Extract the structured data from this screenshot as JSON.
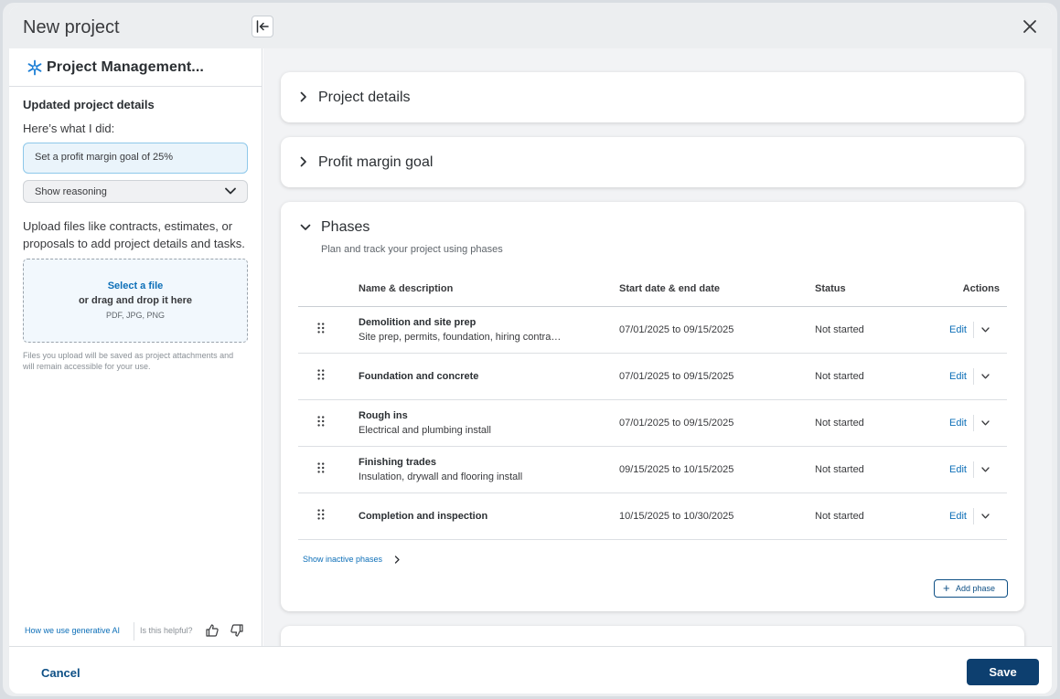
{
  "modal": {
    "title": "New project"
  },
  "sidebar": {
    "title": "Project Management...",
    "heading": "Updated project details",
    "subheading": "Here’s what I did:",
    "ai_action": "Set a profit margin goal of 25%",
    "reasoning_label": "Show reasoning",
    "upload_text": "Upload files like contracts, estimates, or proposals to add project details and tasks.",
    "dropzone": {
      "select_label": "Select a file",
      "drag_text": "or drag and drop it here",
      "types": "PDF, JPG, PNG"
    },
    "files_note": "Files you upload will be saved as project attachments and will remain accessible for your use.",
    "footer": {
      "ai_link": "How we use generative AI",
      "helpful_text": "Is this helpful?"
    }
  },
  "sections": [
    {
      "title": "Project details",
      "expanded": false
    },
    {
      "title": "Profit margin goal",
      "expanded": false
    }
  ],
  "phases": {
    "title": "Phases",
    "subtitle": "Plan and track your project using phases",
    "columns": [
      "Name & description",
      "Start date & end date",
      "Status",
      "Actions"
    ],
    "rows": [
      {
        "name": "Demolition and site prep",
        "description": "Site prep, permits, foundation, hiring contra…",
        "dates": "07/01/2025 to 09/15/2025",
        "status": "Not started",
        "action": "Edit"
      },
      {
        "name": "Foundation and concrete",
        "description": "",
        "dates": "07/01/2025 to 09/15/2025",
        "status": "Not started",
        "action": "Edit"
      },
      {
        "name": "Rough ins",
        "description": "Electrical and plumbing install",
        "dates": "07/01/2025 to 09/15/2025",
        "status": "Not started",
        "action": "Edit"
      },
      {
        "name": "Finishing trades",
        "description": "Insulation, drywall and flooring install",
        "dates": "09/15/2025 to 10/15/2025",
        "status": "Not started",
        "action": "Edit"
      },
      {
        "name": "Completion and inspection",
        "description": "",
        "dates": "10/15/2025 to 10/30/2025",
        "status": "Not started",
        "action": "Edit"
      }
    ],
    "show_inactive": "Show inactive phases",
    "add_phase": "Add phase"
  },
  "footer": {
    "cancel": "Cancel",
    "save": "Save"
  },
  "colors": {
    "accent": "#0d6fb8",
    "primary_button": "#0d3f6f",
    "ai_box": "#eaf4fb"
  },
  "icons": {
    "close": "close-icon",
    "logo": "sparkle-icon",
    "collapse": "collapse-panel-icon",
    "drag": "drag-handle-icon",
    "expand": "chevron-down-icon"
  }
}
